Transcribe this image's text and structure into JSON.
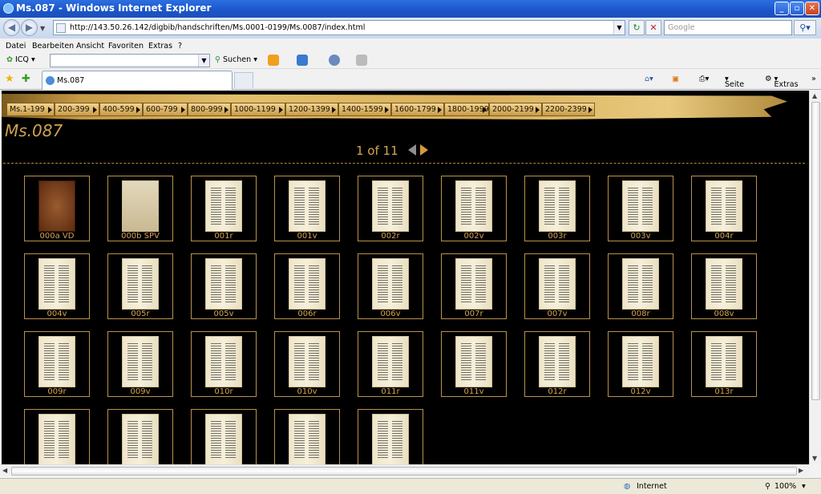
{
  "window": {
    "title": "Ms.087 - Windows Internet Explorer"
  },
  "address": {
    "url": "http://143.50.26.142/digbib/handschriften/Ms.0001-0199/Ms.0087/index.html",
    "search_placeholder": "Google"
  },
  "menu": [
    "Datei",
    "Bearbeiten",
    "Ansicht",
    "Favoriten",
    "Extras",
    "?"
  ],
  "toolbar": {
    "icq_label": "ICQ",
    "search_label": "Suchen"
  },
  "tab": {
    "label": "Ms.087"
  },
  "commandbar": {
    "page_label": "Seite",
    "tools_label": "Extras"
  },
  "nav_ranges": [
    "Ms.1-199",
    "200-399",
    "400-599",
    "600-799",
    "800-999",
    "1000-1199",
    "1200-1399",
    "1400-1599",
    "1600-1799",
    "1800-1999",
    "2000-2199",
    "2200-2399"
  ],
  "page": {
    "title": "Ms.087",
    "pager": "1 of 11"
  },
  "thumbnails": [
    "000a VD",
    "000b SPV",
    "001r",
    "001v",
    "002r",
    "002v",
    "003r",
    "003v",
    "004r",
    "004v",
    "005r",
    "005v",
    "006r",
    "006v",
    "007r",
    "007v",
    "008r",
    "008v",
    "009r",
    "009v",
    "010r",
    "010v",
    "011r",
    "011v",
    "012r",
    "012v",
    "013r",
    "",
    "",
    "",
    "",
    ""
  ],
  "status": {
    "zone": "Internet",
    "zoom": "100%"
  },
  "colors": {
    "accent": "#d7a453",
    "background": "#000000",
    "titlebar": "#1a55c9"
  }
}
